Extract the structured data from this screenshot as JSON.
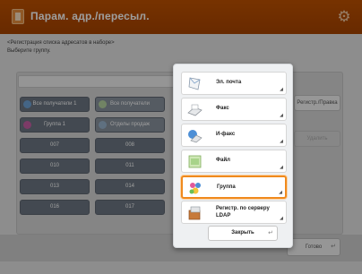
{
  "header": {
    "title": "Парам. адр./пересыл.",
    "settings_icon": "gear-icon"
  },
  "instruction": {
    "line1": "<Регистрация списка адресатов в наборе>",
    "line2": "Выберите группу."
  },
  "address_list": {
    "rows": [
      [
        "Все получатели 1",
        "Все получатели"
      ],
      [
        "Группа 1",
        "Отделы продаж"
      ],
      [
        "007",
        "008"
      ],
      [
        "010",
        "011"
      ],
      [
        "013",
        "014"
      ],
      [
        "016",
        "017"
      ]
    ]
  },
  "side_buttons": {
    "register_print": "Регистр./Правка",
    "delete": "Удалить"
  },
  "footer": {
    "ok_label": "Готово"
  },
  "popup": {
    "items": [
      {
        "label": "Эл. почта",
        "icon": "email-icon"
      },
      {
        "label": "Факс",
        "icon": "fax-icon"
      },
      {
        "label": "И-факс",
        "icon": "ifax-icon"
      },
      {
        "label": "Файл",
        "icon": "file-icon"
      },
      {
        "label": "Группа",
        "icon": "group-icon"
      },
      {
        "label": "Регистр. по серверу LDAP",
        "icon": "ldap-server-icon"
      }
    ],
    "selected_index": 4,
    "close_label": "Закрыть"
  },
  "colors": {
    "title_bar": "#b04a00",
    "selection_border": "#f08a1d"
  }
}
